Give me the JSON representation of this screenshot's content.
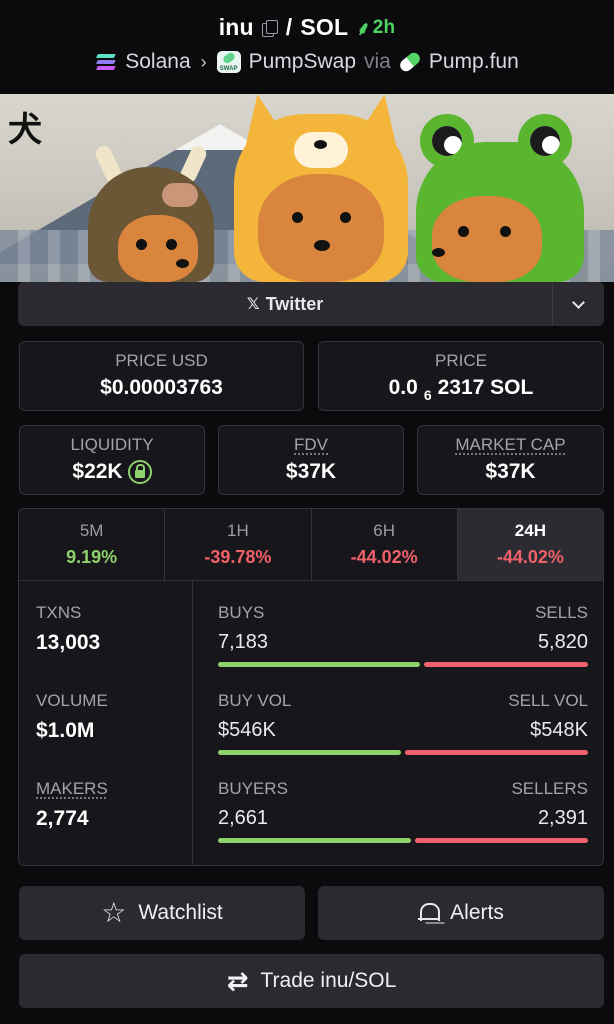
{
  "header": {
    "token": "inu",
    "separator": "/",
    "quote": "SOL",
    "age": "2h",
    "chain": "Solana",
    "dex": "PumpSwap",
    "via": "via",
    "launchpad": "Pump.fun"
  },
  "banner": {
    "kanji": "犬"
  },
  "social": {
    "twitter_label": "Twitter"
  },
  "cards": {
    "price_usd": {
      "label": "PRICE USD",
      "value": "$0.00003763"
    },
    "price_sol": {
      "label": "PRICE",
      "prefix": "0.0",
      "sub": "6",
      "digits": "2317 SOL"
    },
    "liquidity": {
      "label": "LIQUIDITY",
      "value": "$22K"
    },
    "fdv": {
      "label": "FDV",
      "value": "$37K"
    },
    "market_cap": {
      "label": "MARKET CAP",
      "value": "$37K"
    }
  },
  "tabs": [
    {
      "label": "5M",
      "value": "9.19%"
    },
    {
      "label": "1H",
      "value": "-39.78%"
    },
    {
      "label": "6H",
      "value": "-44.02%"
    },
    {
      "label": "24H",
      "value": "-44.02%"
    }
  ],
  "selected_tab": "24H",
  "metrics": {
    "txns": {
      "label": "TXNS",
      "value": "13,003"
    },
    "volume": {
      "label": "VOLUME",
      "value": "$1.0M"
    },
    "makers": {
      "label": "MAKERS",
      "value": "2,774"
    }
  },
  "pairs": {
    "buys_sells": {
      "left_label": "BUYS",
      "right_label": "SELLS",
      "left_value": "7,183",
      "right_value": "5,820",
      "left_share": 0.552
    },
    "vol": {
      "left_label": "BUY VOL",
      "right_label": "SELL VOL",
      "left_value": "$546K",
      "right_value": "$548K",
      "left_share": 0.499
    },
    "buyers_sellers": {
      "left_label": "BUYERS",
      "right_label": "SELLERS",
      "left_value": "2,661",
      "right_value": "2,391",
      "left_share": 0.527
    }
  },
  "actions": {
    "watchlist": "Watchlist",
    "alerts": "Alerts",
    "trade": "Trade inu/SOL"
  },
  "colors": {
    "positive": "#8fd16a",
    "negative": "#f0616a",
    "age": "#4cd361"
  }
}
